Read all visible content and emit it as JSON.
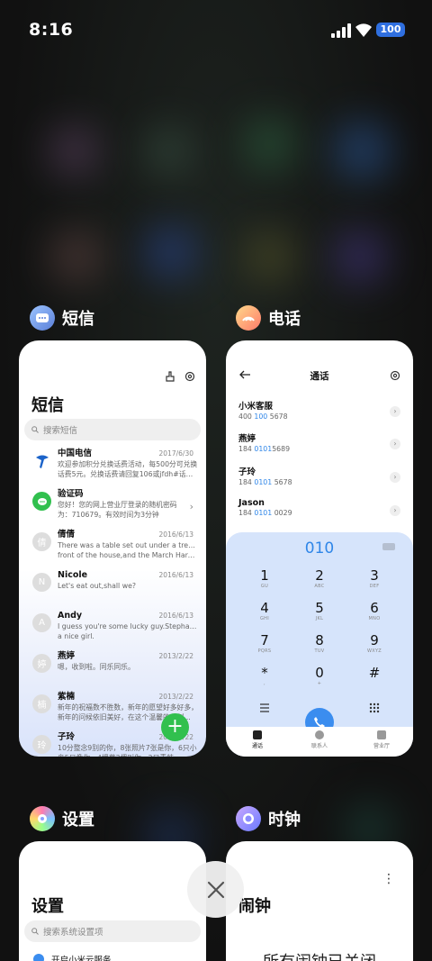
{
  "status_bar": {
    "time": "8:16",
    "battery": "100"
  },
  "apps": {
    "sms": {
      "label": "短信",
      "title": "短信",
      "search_placeholder": "搜索短信",
      "messages": [
        {
          "name": "中国电信",
          "date": "2017/6/30",
          "line1": "欢迎参加积分兑换话费活动，每500分可兑换",
          "line2": "话费5元。兑换话费请回复106或jfdh#话费..."
        },
        {
          "name": "验证码",
          "date": "",
          "line1": "您好！您的网上营业厅登录的随机密码",
          "line2": "为：710679。有效时间为3分钟"
        },
        {
          "name": "倩倩",
          "avatar": "倩",
          "date": "2016/6/13",
          "line1": "There was a table set out under a tree in",
          "line2": "front of the house,and the March Hare an..."
        },
        {
          "name": "Nicole",
          "avatar": "N",
          "date": "2016/6/13",
          "line1": "Let's eat out,shall we?",
          "line2": ""
        },
        {
          "name": "Andy",
          "avatar": "A",
          "date": "2016/6/13",
          "line1": "I guess you're some lucky guy.Stephanie is",
          "line2": "a nice girl."
        },
        {
          "name": "燕婷",
          "avatar": "婷",
          "date": "2013/2/22",
          "line1": "嗯，收到啦。同乐同乐。",
          "line2": ""
        },
        {
          "name": "紫楠",
          "avatar": "楠",
          "date": "2013/2/22",
          "line1": "新年的祝福数不胜数，新年的愿望好多好多，",
          "line2": "新年的问候依旧美好，在这个温馨的时刻..."
        },
        {
          "name": "子玲",
          "avatar": "玲",
          "date": "2013/2/22",
          "line1": "10分整念9别的你，8张照片7张是你，6只小",
          "line2": "鸟5只像你，4棵草3棵叫你，2只青蛙..."
        }
      ]
    },
    "phone": {
      "label": "电话",
      "title": "通话",
      "contacts": [
        {
          "name": "小米客服",
          "pre": "400 ",
          "hl": "100",
          "post": " 5678"
        },
        {
          "name": "燕婷",
          "pre": "184 ",
          "hl": "0101",
          "post": "5689"
        },
        {
          "name": "子玲",
          "pre": "184 ",
          "hl": "0101",
          "post": " 5678"
        },
        {
          "name": "Jason",
          "pre": "184 ",
          "hl": "0101",
          "post": " 0029"
        }
      ],
      "dial_input": "010",
      "keys": [
        {
          "num": "1",
          "letters": "GU"
        },
        {
          "num": "2",
          "letters": "ABC"
        },
        {
          "num": "3",
          "letters": "DEF"
        },
        {
          "num": "4",
          "letters": "GHI"
        },
        {
          "num": "5",
          "letters": "JKL"
        },
        {
          "num": "6",
          "letters": "MNO"
        },
        {
          "num": "7",
          "letters": "PQRS"
        },
        {
          "num": "8",
          "letters": "TUV"
        },
        {
          "num": "9",
          "letters": "WXYZ"
        },
        {
          "num": "*",
          "letters": ","
        },
        {
          "num": "0",
          "letters": "+"
        },
        {
          "num": "#",
          "letters": ""
        }
      ],
      "tabs": [
        "通话",
        "联系人",
        "营业厅"
      ]
    },
    "settings": {
      "label": "设置",
      "title": "设置",
      "search_placeholder": "搜索系统设置项",
      "first_item": "开启小米云服务"
    },
    "clock": {
      "label": "时钟",
      "title": "闹钟",
      "empty_text": "所有闹钟已关闭"
    }
  },
  "colors": {
    "accent": "#2f86e8",
    "fab": "#31c04e",
    "dialpad_bg": "#d6e4fb"
  }
}
